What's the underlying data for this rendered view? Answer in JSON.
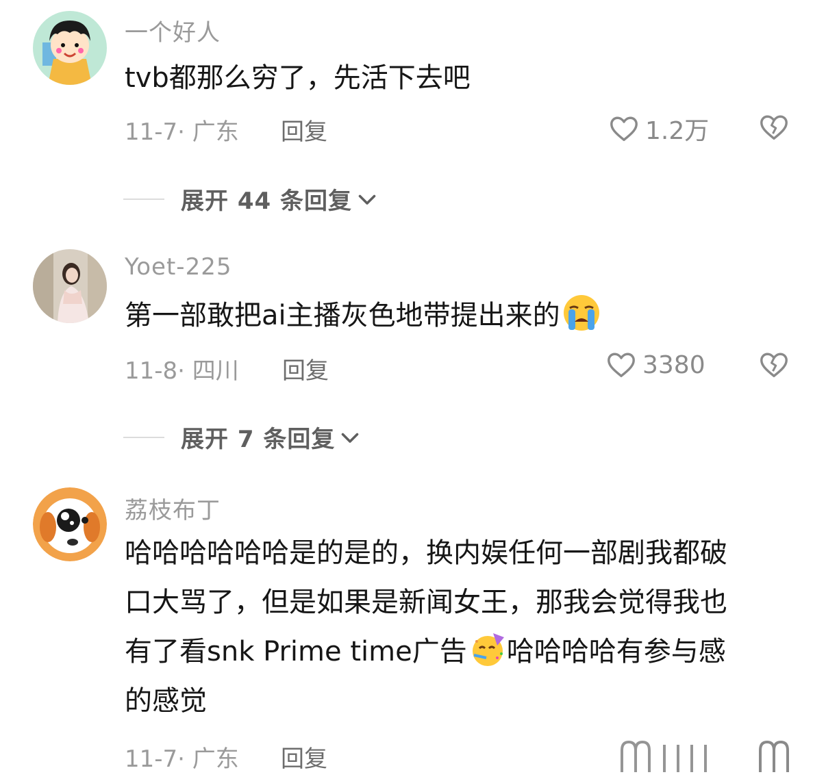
{
  "comments": [
    {
      "username": "一个好人",
      "content": "tvb都那么穷了，先活下去吧",
      "date_location": "11-7· 广东",
      "reply_label": "回复",
      "likes": "1.2万",
      "expand_label": "展开 44 条回复"
    },
    {
      "username": "Yoet-225",
      "content": "第一部敢把ai主播灰色地带提出来的",
      "date_location": "11-8· 四川",
      "reply_label": "回复",
      "likes": "3380",
      "expand_label": "展开 7 条回复"
    },
    {
      "username": "荔枝布丁",
      "content_lines": [
        "哈哈哈哈哈哈是的是的，换内娱任何一部剧我都破",
        "口大骂了，但是如果是新闻女王，那我会觉得我也",
        "有了看snk Prime time广告",
        "哈哈哈哈有参与感",
        "的感觉"
      ],
      "date_location": "11-7· 广东",
      "reply_label": "回复"
    }
  ],
  "icons": [
    "heart-outline-icon",
    "broken-heart-icon",
    "chevron-down-icon",
    "loudly-crying-emoji",
    "partying-face-emoji"
  ]
}
